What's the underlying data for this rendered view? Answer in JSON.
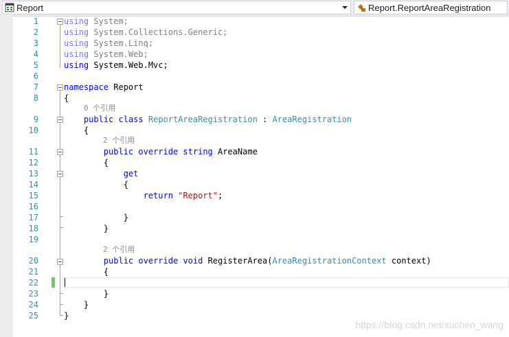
{
  "nav": {
    "left": {
      "icon": "csharp-project-icon",
      "label": "Report"
    },
    "right": {
      "icon": "class-member-icon",
      "label": "Report.ReportAreaRegistration"
    }
  },
  "editor": {
    "line_numbers": [
      "1",
      "2",
      "3",
      "4",
      "5",
      "6",
      "7",
      "8",
      "9",
      "10",
      "11",
      "12",
      "13",
      "14",
      "15",
      "16",
      "17",
      "18",
      "19",
      "20",
      "21",
      "22",
      "23",
      "24",
      "25"
    ],
    "codelens": [
      {
        "before_line": 9,
        "text": "0 个引用"
      },
      {
        "before_line": 11,
        "text": "2 个引用"
      },
      {
        "before_line": 20,
        "text": "2 个引用"
      }
    ],
    "lines": [
      [
        [
          "dim-kw",
          "using"
        ],
        [
          "dim",
          " System;"
        ]
      ],
      [
        [
          "dim-kw",
          "using"
        ],
        [
          "dim",
          " System.Collections.Generic;"
        ]
      ],
      [
        [
          "dim-kw",
          "using"
        ],
        [
          "dim",
          " System.Linq;"
        ]
      ],
      [
        [
          "dim-kw",
          "using"
        ],
        [
          "dim",
          " System.Web;"
        ]
      ],
      [
        [
          "kw",
          "using"
        ],
        [
          "pl",
          " System.Web.Mvc;"
        ]
      ],
      [],
      [
        [
          "kw",
          "namespace"
        ],
        [
          "pl",
          " Report"
        ]
      ],
      [
        [
          "pl",
          "{"
        ]
      ],
      [
        [
          "pl",
          "    "
        ],
        [
          "kw",
          "public"
        ],
        [
          "pl",
          " "
        ],
        [
          "kw",
          "class"
        ],
        [
          "pl",
          " "
        ],
        [
          "typ",
          "ReportAreaRegistration"
        ],
        [
          "pl",
          " : "
        ],
        [
          "typ",
          "AreaRegistration"
        ]
      ],
      [
        [
          "pl",
          "    {"
        ]
      ],
      [
        [
          "pl",
          "        "
        ],
        [
          "kw",
          "public"
        ],
        [
          "pl",
          " "
        ],
        [
          "kw",
          "override"
        ],
        [
          "pl",
          " "
        ],
        [
          "kw",
          "string"
        ],
        [
          "pl",
          " AreaName"
        ]
      ],
      [
        [
          "pl",
          "        {"
        ]
      ],
      [
        [
          "pl",
          "            "
        ],
        [
          "kw",
          "get"
        ]
      ],
      [
        [
          "pl",
          "            {"
        ]
      ],
      [
        [
          "pl",
          "                "
        ],
        [
          "kw",
          "return"
        ],
        [
          "pl",
          " "
        ],
        [
          "str",
          "\"Report\""
        ],
        [
          "pl",
          ";"
        ]
      ],
      [],
      [
        [
          "pl",
          "            }"
        ]
      ],
      [
        [
          "pl",
          "        }"
        ]
      ],
      [],
      [
        [
          "pl",
          "        "
        ],
        [
          "kw",
          "public"
        ],
        [
          "pl",
          " "
        ],
        [
          "kw",
          "override"
        ],
        [
          "pl",
          " "
        ],
        [
          "kw",
          "void"
        ],
        [
          "pl",
          " RegisterArea("
        ],
        [
          "typ",
          "AreaRegistrationContext"
        ],
        [
          "pl",
          " context)"
        ]
      ],
      [
        [
          "pl",
          "        {"
        ]
      ],
      [],
      [
        [
          "pl",
          "        }"
        ]
      ],
      [
        [
          "pl",
          "    }"
        ]
      ],
      [
        [
          "pl",
          "}"
        ]
      ]
    ]
  },
  "watermark": "https://blog.csdn.net/xuchen_wang",
  "colors": {
    "keyword": "#0000ff",
    "type": "#2b91af",
    "string": "#a31515",
    "line_number": "#2b91af",
    "dimmed": "#808080"
  }
}
